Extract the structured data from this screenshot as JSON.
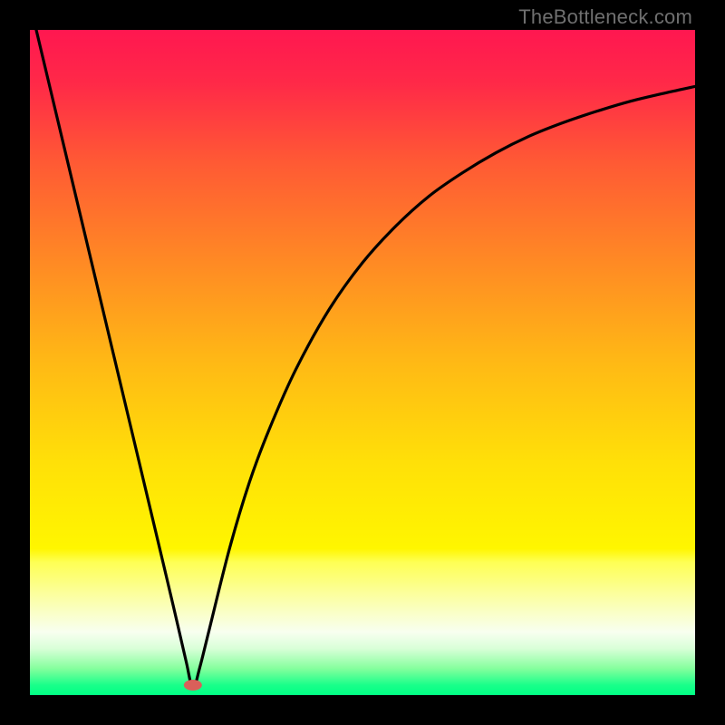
{
  "watermark": "TheBottleneck.com",
  "chart_data": {
    "type": "line",
    "title": "",
    "xlabel": "",
    "ylabel": "",
    "xlim": [
      0,
      100
    ],
    "ylim": [
      0,
      100
    ],
    "background_gradient": {
      "stops": [
        {
          "offset": 0.0,
          "color": "#ff1750"
        },
        {
          "offset": 0.08,
          "color": "#ff2948"
        },
        {
          "offset": 0.2,
          "color": "#ff5a34"
        },
        {
          "offset": 0.35,
          "color": "#ff8a24"
        },
        {
          "offset": 0.5,
          "color": "#ffb915"
        },
        {
          "offset": 0.65,
          "color": "#ffe008"
        },
        {
          "offset": 0.78,
          "color": "#fff600"
        },
        {
          "offset": 0.8,
          "color": "#feff54"
        },
        {
          "offset": 0.86,
          "color": "#fbffb0"
        },
        {
          "offset": 0.905,
          "color": "#f8fff0"
        },
        {
          "offset": 0.93,
          "color": "#d9ffd8"
        },
        {
          "offset": 0.96,
          "color": "#85ff9d"
        },
        {
          "offset": 0.985,
          "color": "#19ff8a"
        },
        {
          "offset": 1.0,
          "color": "#00ff84"
        }
      ]
    },
    "marker": {
      "x": 24.5,
      "y": 1.5,
      "color": "#d9605a",
      "rx": 10,
      "ry": 6
    },
    "series": [
      {
        "name": "bottleneck-curve",
        "x": [
          0,
          5,
          10,
          15,
          20,
          22,
          23.5,
          24.5,
          25.5,
          27,
          30,
          33,
          36,
          40,
          45,
          50,
          55,
          60,
          65,
          70,
          75,
          80,
          85,
          90,
          95,
          100
        ],
        "values": [
          104,
          83,
          62,
          41,
          20,
          11.5,
          5,
          1,
          4,
          10,
          22,
          32,
          40,
          49,
          58,
          65,
          70.5,
          75,
          78.5,
          81.5,
          84,
          86,
          87.7,
          89.2,
          90.4,
          91.5
        ]
      }
    ]
  }
}
